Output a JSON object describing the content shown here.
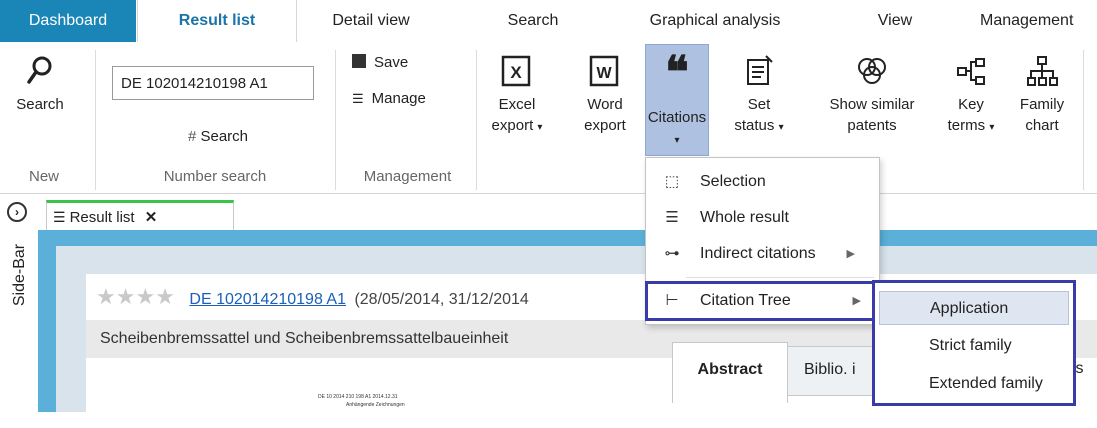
{
  "tabs": [
    "Dashboard",
    "Result list",
    "Detail view",
    "Search",
    "Graphical analysis",
    "View",
    "Management"
  ],
  "ribbon": {
    "search_label": "Search",
    "number_input_value": "DE 102014210198 A1",
    "number_search_button": "Search",
    "number_search_hash": "#",
    "save_label": "Save",
    "manage_label": "Manage",
    "excel_line1": "Excel",
    "excel_line2": "export",
    "word_line1": "Word",
    "word_line2": "export",
    "citations_label": "Citations",
    "set_status_line1": "Set",
    "set_status_line2": "status",
    "similar_line1": "Show similar",
    "similar_line2": "patents",
    "key_terms_line1": "Key",
    "key_terms_line2": "terms",
    "family_chart_line1": "Family",
    "family_chart_line2": "chart",
    "group_new": "New",
    "group_number_search": "Number search",
    "group_management": "Management"
  },
  "sidebar_label": "Side-Bar",
  "doc_tab_label": "Result list",
  "result": {
    "number": "DE 102014210198 A1",
    "dates": "(28/05/2014, 31/12/2014",
    "title": "Scheibenbremssattel und Scheibenbremssattelbaueinheit",
    "thumb_text_1": "DE 10 2014 210 198 A1   2014.12.31",
    "thumb_text_2": "Anhängende Zeichnungen"
  },
  "citations_menu": [
    {
      "icon": "selection-icon",
      "label": "Selection",
      "has_submenu": false
    },
    {
      "icon": "list-icon",
      "label": "Whole result",
      "has_submenu": false
    },
    {
      "icon": "indirect-citations-icon",
      "label": "Indirect citations",
      "has_submenu": true
    },
    {
      "icon": "tree-icon",
      "label": "Citation Tree",
      "has_submenu": true
    }
  ],
  "citation_tree_submenu": [
    "Application",
    "Strict family",
    "Extended family"
  ],
  "detail_tabs": {
    "abstract": "Abstract",
    "biblio": "Biblio. i",
    "partial": "ls"
  },
  "colors": {
    "accent": "#1a86b8",
    "highlight_border": "#3a3aa8",
    "active_tab_indicator": "#3ac44a"
  }
}
